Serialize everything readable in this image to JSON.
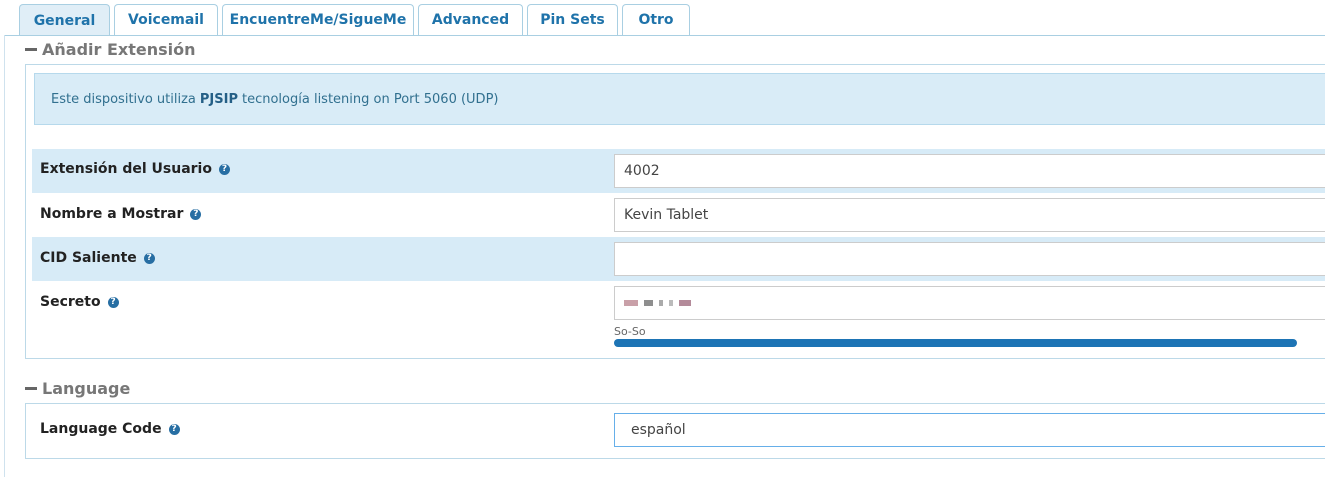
{
  "tabs": [
    {
      "label": "General",
      "active": true
    },
    {
      "label": "Voicemail",
      "active": false
    },
    {
      "label": "EncuentreMe/SigueMe",
      "active": false
    },
    {
      "label": "Advanced",
      "active": false
    },
    {
      "label": "Pin Sets",
      "active": false
    },
    {
      "label": "Otro",
      "active": false
    }
  ],
  "sections": {
    "add_extension": {
      "title": "Añadir Extensión"
    },
    "language": {
      "title": "Language"
    }
  },
  "info": {
    "prefix": "Este dispositivo utiliza",
    "tech": "PJSIP",
    "suffix": "tecnología listening on Port 5060 (UDP)"
  },
  "fields": {
    "extension": {
      "label": "Extensión del Usuario",
      "value": "4002"
    },
    "display_name": {
      "label": "Nombre a Mostrar",
      "value": "Kevin Tablet"
    },
    "outbound_cid": {
      "label": "CID Saliente",
      "value": ""
    },
    "secret": {
      "label": "Secreto",
      "value": "",
      "strength_label": "So-So",
      "strength_percent": 96
    },
    "language_code": {
      "label": "Language Code",
      "value": "español"
    }
  },
  "icons": {
    "help": "help-icon",
    "collapse": "minus-icon"
  },
  "colors": {
    "accent": "#1f73aa",
    "info_bg": "#d9ecf7",
    "row_shade": "#d7ebf7",
    "strength_bar": "#1d74b5"
  }
}
